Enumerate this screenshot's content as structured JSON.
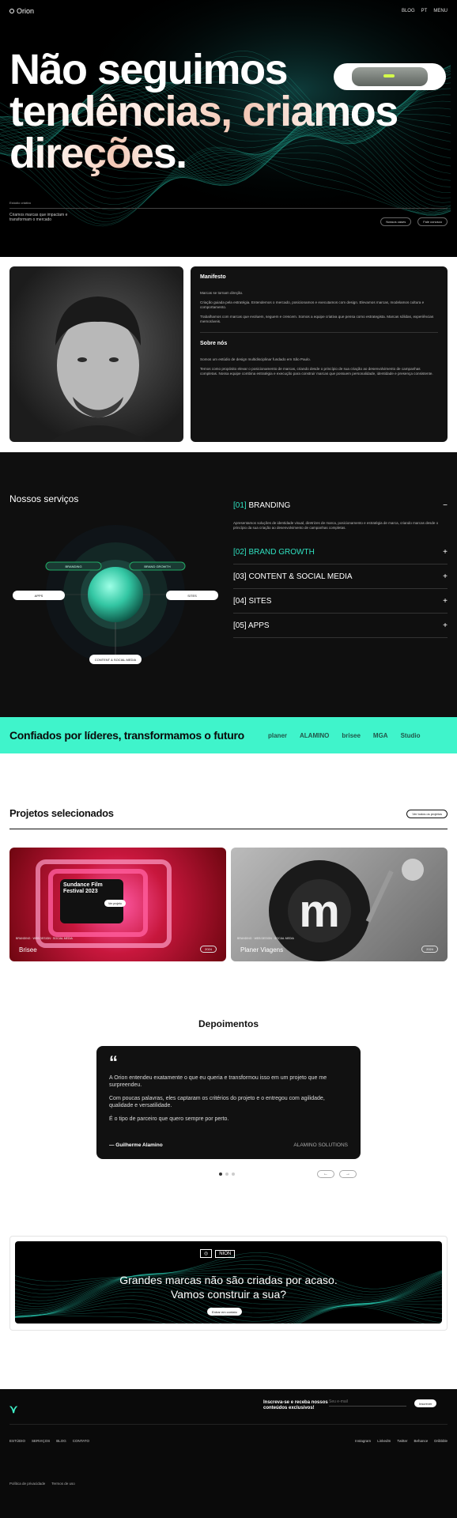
{
  "nav": {
    "logo": "Orion",
    "items": [
      "BLOG",
      "PT",
      "MENU"
    ]
  },
  "hero": {
    "line1": "Não seguimos",
    "line2": "tendências, criamos",
    "line3": "direções.",
    "small": "Estúdio criativo",
    "sub": "Criamos marcas que impactam e transformam o mercado",
    "btn1": "Nossos cases",
    "btn2": "Fale conosco"
  },
  "about": {
    "manifesto_title": "Manifesto",
    "manifesto_p1": "Marcas se tornam direção.",
    "manifesto_p2": "Criação guiada pela estratégia. Entendemos o mercado, posicionamos e executamos com design. Elevamos marcas, modelamos cultura e comportamento.",
    "manifesto_p3": "Trabalhamos com marcas que evoluem, seguem e crescem. Somos a equipe criativa que pensa como estrategista. Marcas sólidas, experiências memoráveis.",
    "sobre_title": "Sobre nós",
    "sobre_p1": "Somos um estúdio de design multidisciplinar fundado em São Paulo.",
    "sobre_p2": "Temos como propósito elevar o posicionamento de marcas, criando desde o princípio de sua criação ao desenvolvimento de campanhas completas. Nossa equipe combina estratégia e execução para construir marcas que possuem personalidade, identidade e presença consistente."
  },
  "services": {
    "title": "Nossos serviços",
    "items": [
      {
        "num": "[01]",
        "label": "BRANDING",
        "sign": "−",
        "desc": "Apresentamos soluções de identidade visual, diretrizes de marca, posicionamento e estratégia de marca, criando marcas desde o princípio da sua criação ao desenvolvimento de campanhas completas."
      },
      {
        "num": "[02]",
        "label": "BRAND GROWTH",
        "sign": "+"
      },
      {
        "num": "[03]",
        "label": "CONTENT & SOCIAL MEDIA",
        "sign": "+"
      },
      {
        "num": "[04]",
        "label": "SITES",
        "sign": "+"
      },
      {
        "num": "[05]",
        "label": "APPS",
        "sign": "+"
      }
    ],
    "diagram": {
      "chip_tl": "BRANDING",
      "chip_tr": "BRAND GROWTH",
      "chip_l": "APPS",
      "chip_r": "SITES",
      "chip_b": "CONTENT & SOCIAL MEDIA"
    }
  },
  "clients": {
    "title": "Confiados por líderes, transformamos o futuro",
    "logos": [
      "planer",
      "ALAMINO",
      "brisee",
      "MGA",
      "Studio"
    ]
  },
  "projects": {
    "title": "Projetos selecionados",
    "button": "Ver todos os projetos",
    "items": [
      {
        "name": "Brisee",
        "tags": "BRANDING · WEB DESIGN · SOCIAL MEDIA",
        "year": "2024",
        "poster": "Sundance Film Festival 2023",
        "poster_btn": "Ver projeto"
      },
      {
        "name": "Planer Viagens",
        "tags": "BRANDING · WEB DESIGN · SOCIAL MEDIA",
        "year": "2024"
      }
    ]
  },
  "testimonials": {
    "title": "Depoimentos",
    "quote_mark": "“",
    "p1": "A Orion entendeu exatamente o que eu queria e transformou isso em um projeto que me surpreendeu.",
    "p2": "Com poucas palavras, eles captaram os critérios do projeto e o entregou com agilidade, qualidade e versatilidade.",
    "p3": "É o tipo de parceiro que quero sempre por perto.",
    "author": "— Guilherme Alamino",
    "company": "ALAMINO SOLUTIONS",
    "prev": "←",
    "next": "→"
  },
  "cta": {
    "brand": "NION",
    "line1": "Grandes marcas não são criadas por acaso.",
    "line2": "Vamos construir a sua?",
    "button": "Entrar em contato"
  },
  "footer": {
    "newsletter": "Inscreva-se e receba nossos conteúdos exclusivos!",
    "input_placeholder": "Seu e-mail",
    "button": "Inscrever",
    "links": [
      "ESTÚDIO",
      "SERVIÇOS",
      "BLOG",
      "CONTATO"
    ],
    "social": [
      "Instagram",
      "LinkedIn",
      "Twitter",
      "Behance",
      "Dribbble"
    ],
    "legal": [
      "Política de privacidade",
      "Termos de uso"
    ]
  },
  "colors": {
    "accent": "#3ff4cb",
    "dark": "#0d0d0d"
  }
}
